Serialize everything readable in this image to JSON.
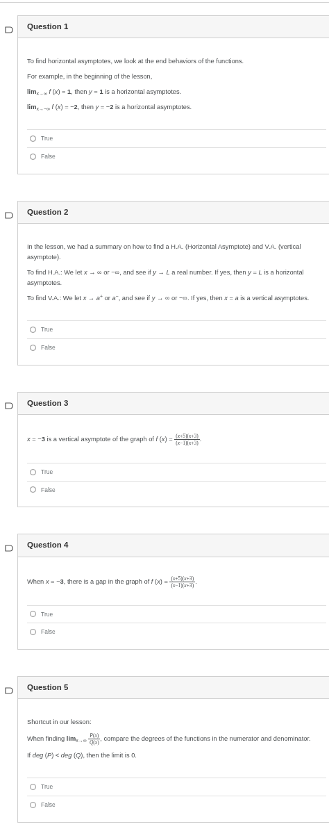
{
  "questions": [
    {
      "title": "Question 1",
      "paragraphs": [
        [
          {
            "kind": "text",
            "text": "To find horizontal asymptotes, we look at the end behaviors of the functions."
          }
        ],
        [
          {
            "kind": "text",
            "text": "For example, in the beginning of the lesson,"
          }
        ],
        [
          {
            "kind": "text",
            "text": "**lim**$_{x→∞}$ *f* (*x*) = **1**, then *y* = **1** is a horizontal asymptotes."
          }
        ],
        [
          {
            "kind": "text",
            "text": "**lim**$_{x→−∞}$ *f* (*x*) = −**2**, then *y* = −**2** is a horizontal asymptotes."
          }
        ]
      ],
      "options": [
        {
          "label": "True",
          "selected": false
        },
        {
          "label": "False",
          "selected": false
        }
      ]
    },
    {
      "title": "Question 2",
      "paragraphs": [
        [
          {
            "kind": "text",
            "text": "In the lesson, we had a summary on how to find a H.A. (Horizontal Asymptote) and V.A. (vertical asymptote)."
          }
        ],
        [
          {
            "kind": "text",
            "text": "To find H.A.: We let *x* → ∞ or −∞, and see if *y* → *L*  a real number. If yes, then *y* = *L* is a horizontal asymptotes."
          }
        ],
        [
          {
            "kind": "text",
            "text": "To find V.A.: We let *x* → *a*$^{+}$ or *a*$^{−}$, and see if *y* → ∞ or −∞. If yes, then *x* = *a* is a vertical asymptotes."
          }
        ]
      ],
      "options": [
        {
          "label": "True",
          "selected": false
        },
        {
          "label": "False",
          "selected": false
        }
      ]
    },
    {
      "title": "Question 3",
      "paragraphs": [
        [
          {
            "kind": "text",
            "text": "*x* = −**3** is a vertical asymptote of the graph of *f* (*x*) = "
          },
          {
            "kind": "fraction",
            "numerator": "(*x*+5)(*x*+3)",
            "denominator": "(*x*−1)(*x*+3)"
          },
          {
            "kind": "text",
            "text": "."
          }
        ]
      ],
      "options": [
        {
          "label": "True",
          "selected": false
        },
        {
          "label": "False",
          "selected": false
        }
      ]
    },
    {
      "title": "Question 4",
      "paragraphs": [
        [
          {
            "kind": "text",
            "text": "When *x* = −**3**, there is a gap in the graph of *f* (*x*) = "
          },
          {
            "kind": "fraction",
            "numerator": "(*x*+5)(*x*+3)",
            "denominator": "(*x*−1)(*x*+3)"
          },
          {
            "kind": "text",
            "text": "."
          }
        ]
      ],
      "options": [
        {
          "label": "True",
          "selected": false
        },
        {
          "label": "False",
          "selected": false
        }
      ]
    },
    {
      "title": "Question 5",
      "paragraphs": [
        [
          {
            "kind": "text",
            "text": "Shortcut in our lesson:"
          }
        ],
        [
          {
            "kind": "text",
            "text": "When finding **lim**$_{x→∞}$ "
          },
          {
            "kind": "fraction",
            "numerator": "*P*(*x*)",
            "denominator": "*Q*(*x*)"
          },
          {
            "kind": "text",
            "text": ", compare the degrees of the functions in the numerator and denominator."
          }
        ],
        [
          {
            "kind": "text",
            "text": "If *deg* (*P*) < *deg* (*Q*), then the limit is 0."
          }
        ]
      ],
      "options": [
        {
          "label": "True",
          "selected": false
        },
        {
          "label": "False",
          "selected": false
        }
      ]
    }
  ]
}
